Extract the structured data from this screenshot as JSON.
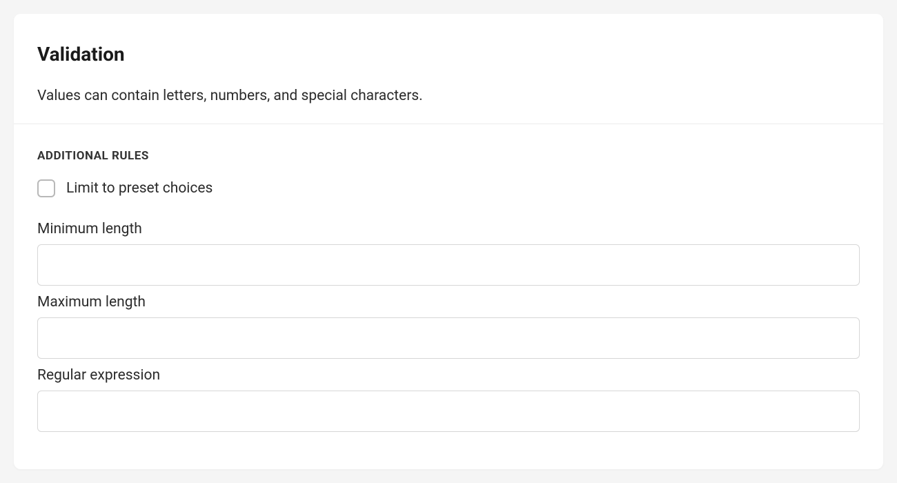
{
  "header": {
    "title": "Validation",
    "description": "Values can contain letters, numbers, and special characters."
  },
  "section": {
    "label": "ADDITIONAL RULES"
  },
  "preset": {
    "label": "Limit to preset choices",
    "checked": false
  },
  "fields": {
    "min_length": {
      "label": "Minimum length",
      "value": ""
    },
    "max_length": {
      "label": "Maximum length",
      "value": ""
    },
    "regex": {
      "label": "Regular expression",
      "value": ""
    }
  }
}
